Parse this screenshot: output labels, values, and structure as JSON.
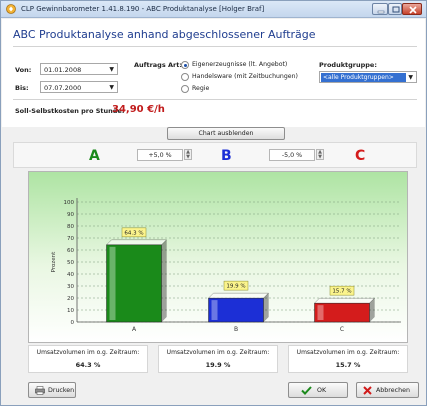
{
  "window": {
    "title": "CLP Gewinnbarometer 1.41.8.190 - ABC Produktanalyse  [Holger Braf]"
  },
  "header": {
    "title": "ABC Produktanalyse anhand abgeschlossener Aufträge"
  },
  "filters": {
    "von_label": "Von:",
    "von_value": "01.01.2008",
    "bis_label": "Bis:",
    "bis_value": "07.07.2000",
    "auftrags_art_label": "Auftrags Art:",
    "options": [
      "Eigenerzeugnisse (lt. Angebot)",
      "Handelsware (mit Zeitbuchungen)",
      "Regie"
    ],
    "selected_option": 0,
    "produktgruppe_label": "Produktgruppe:",
    "produktgruppe_value": "<alle Produktgruppen>"
  },
  "cost": {
    "label": "Soll-Selbstkosten pro Stunde:",
    "value": "34,90 €/h"
  },
  "chart_toggle_label": "Chart ausblenden",
  "thresholds": {
    "A": "A",
    "ab_value": "+5,0 %",
    "B": "B",
    "bc_value": "-5,0 %",
    "C": "C"
  },
  "colors": {
    "A": "#1a8a1a",
    "B": "#1c2fd6",
    "C": "#d41c1c"
  },
  "chart_data": {
    "type": "bar",
    "categories": [
      "A",
      "B",
      "C"
    ],
    "values": [
      64.3,
      19.9,
      15.7
    ],
    "value_labels": [
      "64.3 %",
      "19.9 %",
      "15.7 %"
    ],
    "ylabel": "Prozent",
    "yticks": [
      0,
      10,
      20,
      30,
      40,
      50,
      60,
      70,
      80,
      90,
      100
    ],
    "ylim": [
      0,
      100
    ],
    "grid": true
  },
  "volumes": [
    {
      "label": "Umsatzvolumen im o.g. Zeitraum:",
      "value": "64.3 %"
    },
    {
      "label": "Umsatzvolumen im o.g. Zeitraum:",
      "value": "19.9 %"
    },
    {
      "label": "Umsatzvolumen im o.g. Zeitraum:",
      "value": "15.7 %"
    }
  ],
  "footer": {
    "print_label": "Drucken",
    "ok_label": "OK",
    "cancel_label": "Abbrechen"
  }
}
